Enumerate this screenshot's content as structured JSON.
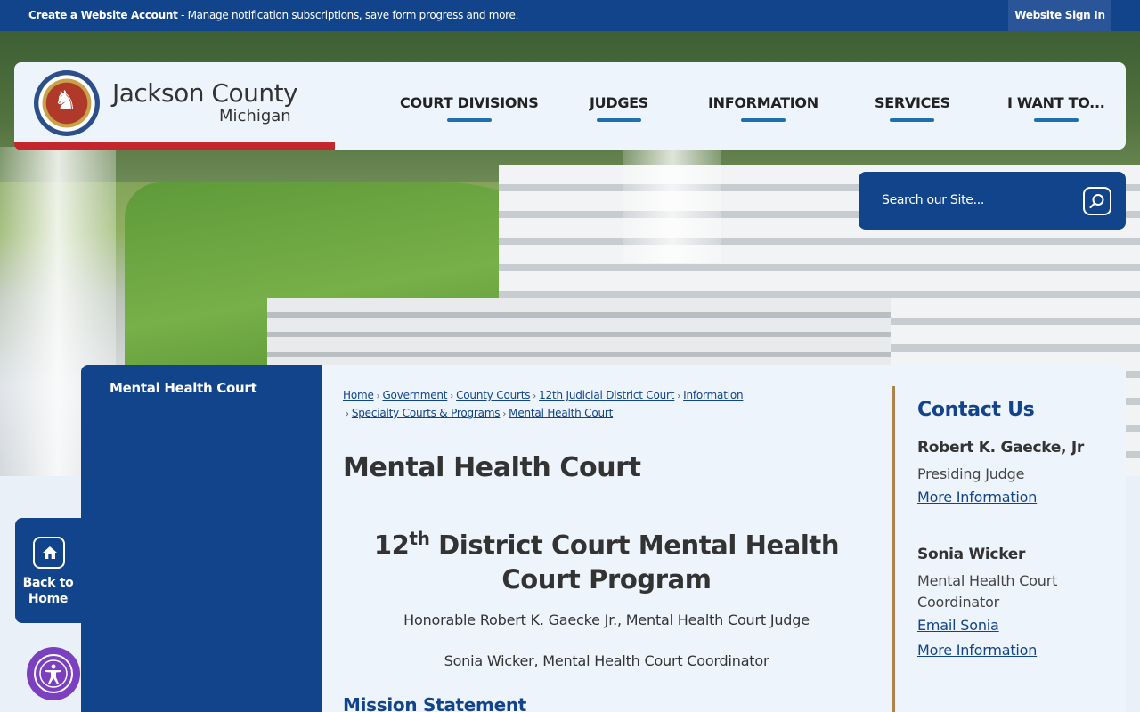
{
  "topbar": {
    "create_account": "Create a Website Account",
    "message": " - Manage notification subscriptions, save form progress and more.",
    "sign_in": "Website Sign In"
  },
  "logo": {
    "title": "Jackson County",
    "subtitle": "Michigan"
  },
  "nav": [
    "COURT DIVISIONS",
    "JUDGES",
    "INFORMATION",
    "SERVICES",
    "I WANT TO..."
  ],
  "search": {
    "placeholder": "Search our Site..."
  },
  "sidenav": {
    "item": "Mental Health Court"
  },
  "back_home": {
    "line1": "Back to",
    "line2": "Home"
  },
  "breadcrumbs": [
    "Home",
    "Government",
    "County Courts",
    "12th Judicial District Court",
    "Information",
    "Specialty Courts & Programs",
    "Mental Health Court"
  ],
  "content": {
    "page_title": "Mental Health Court",
    "heading_num": "12",
    "heading_sup": "th",
    "heading_rest": " District Court Mental Health Court Program",
    "judge_line": "Honorable Robert K. Gaecke Jr., Mental Health Court Judge",
    "coord_line": "Sonia Wicker, Mental Health Court Coordinator",
    "mission": "Mission Statement"
  },
  "contact": {
    "title": "Contact Us",
    "person1": {
      "name": "Robert K. Gaecke, Jr",
      "role": "Presiding Judge",
      "link": "More Information"
    },
    "person2": {
      "name": "Sonia Wicker",
      "role": "Mental Health Court Coordinator",
      "email": "Email Sonia",
      "link": "More Information"
    }
  },
  "colors": {
    "brand_blue": "#12448c",
    "accent_red": "#c4262e",
    "divider_gold": "#b0814a",
    "a11y_purple": "#7b3fc0"
  }
}
